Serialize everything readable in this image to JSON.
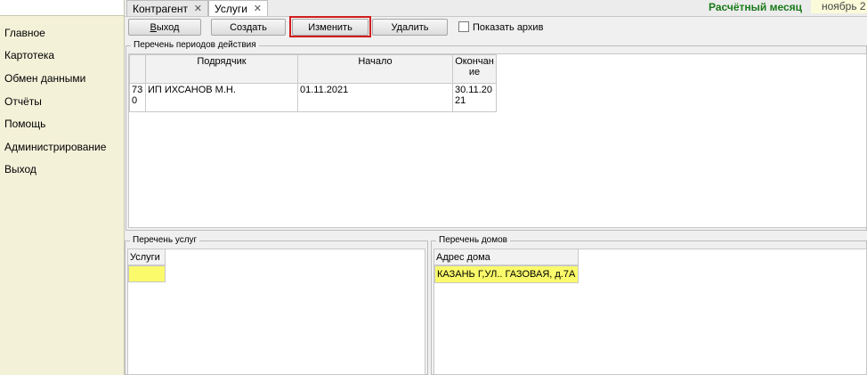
{
  "sidebar": {
    "items": [
      {
        "label": "Главное"
      },
      {
        "label": "Картотека"
      },
      {
        "label": "Обмен данными"
      },
      {
        "label": "Отчёты"
      },
      {
        "label": "Помощь"
      },
      {
        "label": "Администрирование"
      },
      {
        "label": "Выход"
      }
    ]
  },
  "tabs": [
    {
      "label": "Контрагент",
      "close": "✕"
    },
    {
      "label": "Услуги",
      "close": "✕"
    }
  ],
  "header": {
    "month_label": "Расчётный месяц",
    "month_value": "ноябрь 2"
  },
  "toolbar": {
    "exit_label_first": "В",
    "exit_label_rest": "ыход",
    "create_label": "Создать",
    "edit_label": "Изменить",
    "delete_label": "Удалить",
    "archive_label": "Показать архив"
  },
  "periods": {
    "title": "Перечень периодов действия",
    "columns": [
      "",
      "Подрядчик",
      "Начало",
      "Окончание"
    ],
    "rows": [
      {
        "id": "730",
        "contractor": "ИП ИХСАНОВ М.Н.",
        "start": "01.11.2021",
        "end": "30.11.2021"
      }
    ]
  },
  "services": {
    "title": "Перечень услуг",
    "column": "Услуги"
  },
  "houses": {
    "title": "Перечень домов",
    "column": "Адрес дома",
    "rows": [
      {
        "address": "КАЗАНЬ Г,УЛ.. ГАЗОВАЯ, д.7А"
      }
    ]
  },
  "colors": {
    "sidebar_bg": "#f4f1d9",
    "month_label": "#1a7a1a",
    "selection_yellow": "#fafa6b",
    "highlight_red": "#d21d1d"
  }
}
